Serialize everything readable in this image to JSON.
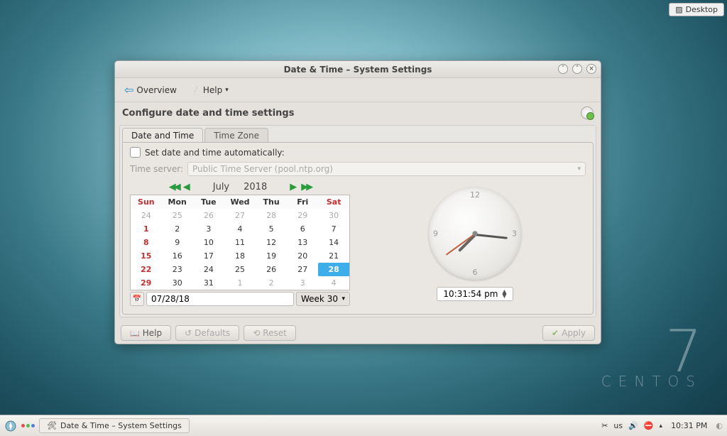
{
  "desktop": {
    "button": "Desktop"
  },
  "branding": {
    "number": "7",
    "text": "CENTOS"
  },
  "window": {
    "title": "Date & Time – System Settings",
    "toolbar": {
      "overview": "Overview",
      "help": "Help"
    },
    "subtitle": "Configure date and time settings",
    "tabs": {
      "date_time": "Date and Time",
      "time_zone": "Time Zone"
    },
    "auto_checkbox": "Set date and time automatically:",
    "time_server_label": "Time server:",
    "time_server_value": "Public Time Server (pool.ntp.org)",
    "calendar": {
      "month": "July",
      "year": "2018",
      "dow": [
        "Sun",
        "Mon",
        "Tue",
        "Wed",
        "Thu",
        "Fri",
        "Sat"
      ],
      "rows": [
        [
          {
            "d": "24",
            "o": true
          },
          {
            "d": "25",
            "o": true
          },
          {
            "d": "26",
            "o": true
          },
          {
            "d": "27",
            "o": true
          },
          {
            "d": "28",
            "o": true
          },
          {
            "d": "29",
            "o": true
          },
          {
            "d": "30",
            "o": true
          }
        ],
        [
          {
            "d": "1",
            "sun": true
          },
          {
            "d": "2"
          },
          {
            "d": "3"
          },
          {
            "d": "4"
          },
          {
            "d": "5"
          },
          {
            "d": "6"
          },
          {
            "d": "7"
          }
        ],
        [
          {
            "d": "8",
            "sun": true
          },
          {
            "d": "9"
          },
          {
            "d": "10"
          },
          {
            "d": "11"
          },
          {
            "d": "12"
          },
          {
            "d": "13"
          },
          {
            "d": "14"
          }
        ],
        [
          {
            "d": "15",
            "sun": true
          },
          {
            "d": "16"
          },
          {
            "d": "17"
          },
          {
            "d": "18"
          },
          {
            "d": "19"
          },
          {
            "d": "20"
          },
          {
            "d": "21"
          }
        ],
        [
          {
            "d": "22",
            "sun": true
          },
          {
            "d": "23"
          },
          {
            "d": "24"
          },
          {
            "d": "25"
          },
          {
            "d": "26"
          },
          {
            "d": "27"
          },
          {
            "d": "28",
            "sel": true
          }
        ],
        [
          {
            "d": "29",
            "sun": true
          },
          {
            "d": "30"
          },
          {
            "d": "31"
          },
          {
            "d": "1",
            "o": true
          },
          {
            "d": "2",
            "o": true
          },
          {
            "d": "3",
            "o": true
          },
          {
            "d": "4",
            "o": true
          }
        ]
      ],
      "date_input": "07/28/18",
      "week_label": "Week 30"
    },
    "clock": {
      "numbers": {
        "12": "12",
        "3": "3",
        "6": "6",
        "9": "9"
      },
      "time_display": "10:31:54 pm",
      "hour_angle": 225,
      "minute_angle": 96,
      "second_angle": 234
    },
    "footer": {
      "help": "Help",
      "defaults": "Defaults",
      "reset": "Reset",
      "apply": "Apply"
    }
  },
  "taskbar": {
    "task_title": "Date & Time – System Settings",
    "kb_layout": "us",
    "clock": "10:31 PM"
  }
}
